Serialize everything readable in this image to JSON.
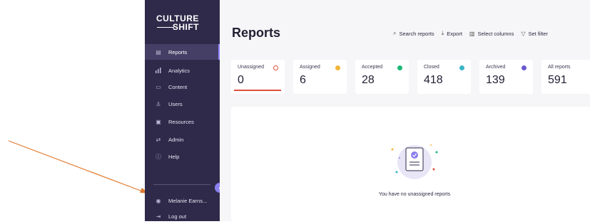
{
  "brand": {
    "line1": "CULTURE",
    "line2": "SHIFT"
  },
  "sidebar": {
    "items": [
      {
        "label": "Reports",
        "icon": "report-icon",
        "active": true
      },
      {
        "label": "Analytics",
        "icon": "bar-chart-icon"
      },
      {
        "label": "Content",
        "icon": "image-icon"
      },
      {
        "label": "Users",
        "icon": "user-icon"
      },
      {
        "label": "Resources",
        "icon": "folder-icon"
      },
      {
        "label": "Admin",
        "icon": "sliders-icon"
      },
      {
        "label": "Help",
        "icon": "info-icon"
      }
    ],
    "user_name": "Melanie Earns...",
    "logout_label": "Log out"
  },
  "main": {
    "title": "Reports",
    "toolbar": {
      "search": "Search reports",
      "export": "Export",
      "select_columns": "Select columns",
      "set_filter": "Set filter"
    },
    "stats": [
      {
        "label": "Unassigned",
        "value": "0",
        "color": "#e0503b",
        "selected": true
      },
      {
        "label": "Assigned",
        "value": "6",
        "color": "#f2b53b"
      },
      {
        "label": "Accepted",
        "value": "28",
        "color": "#1eb97a"
      },
      {
        "label": "Closed",
        "value": "418",
        "color": "#3bb5c7"
      },
      {
        "label": "Archived",
        "value": "139",
        "color": "#6a5acd"
      },
      {
        "label": "All reports",
        "value": "591",
        "color": "#2f2a4a"
      }
    ],
    "empty_message": "You have no unassigned reports"
  },
  "colors": {
    "sidebar_bg": "#2f2a4a",
    "accent": "#8a7ff0",
    "annotation_arrow": "#e07a2e"
  }
}
